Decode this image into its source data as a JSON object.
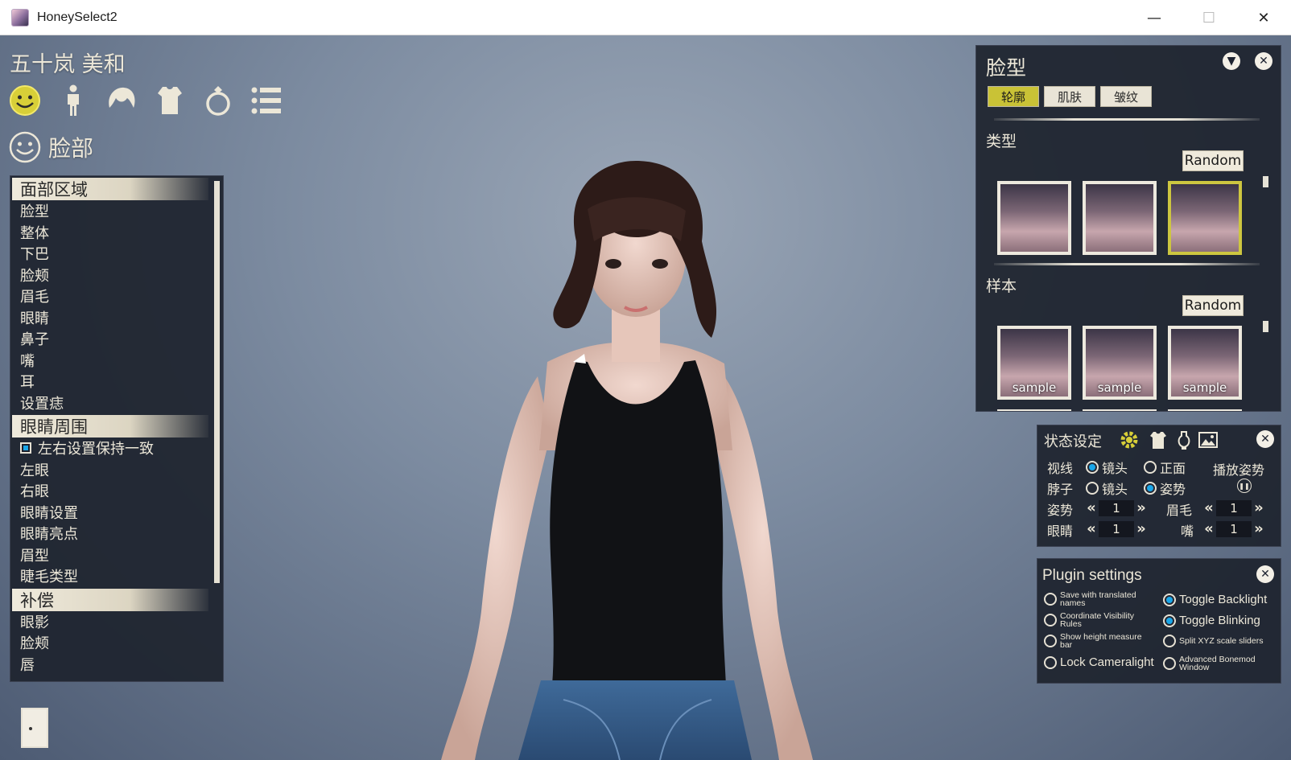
{
  "window": {
    "title": "HoneySelect2",
    "minimize": "—",
    "maximize": "☐",
    "close": "✕"
  },
  "character": {
    "name": "五十岚 美和"
  },
  "category_icons": [
    "face-icon",
    "body-icon",
    "hair-icon",
    "clothing-icon",
    "accessory-icon",
    "list-icon"
  ],
  "section": {
    "label": "脸部"
  },
  "left_menu": {
    "groups": [
      {
        "label": "面部区域",
        "items": [
          "脸型",
          "整体",
          "下巴",
          "脸颊",
          "眉毛",
          "眼睛",
          "鼻子",
          "嘴",
          "耳",
          "设置痣"
        ]
      },
      {
        "label": "眼睛周围",
        "check_item": "左右设置保持一致",
        "items": [
          "左眼",
          "右眼",
          "眼睛设置",
          "眼睛亮点",
          "眉型",
          "睫毛类型"
        ]
      },
      {
        "label": "补偿",
        "items": [
          "眼影",
          "脸颊",
          "唇"
        ]
      }
    ]
  },
  "face_panel": {
    "title": "脸型",
    "tabs": [
      {
        "label": "轮廓",
        "active": true
      },
      {
        "label": "肌肤",
        "active": false
      },
      {
        "label": "皱纹",
        "active": false
      }
    ],
    "type_label": "类型",
    "sample_label": "样本",
    "random_label": "Random",
    "type_selected_index": 2,
    "sample_caption": "sample"
  },
  "state_panel": {
    "title": "状态设定",
    "gaze_label": "视线",
    "gaze_camera": "镜头",
    "gaze_front": "正面",
    "neck_label": "脖子",
    "neck_camera": "镜头",
    "neck_pose": "姿势",
    "play_pose": "播放姿势",
    "pose_label": "姿势",
    "pose_value": "1",
    "brow_label": "眉毛",
    "brow_value": "1",
    "eyes_label": "眼睛",
    "eyes_value": "1",
    "mouth_label": "嘴",
    "mouth_value": "1"
  },
  "plugin_panel": {
    "title": "Plugin settings",
    "left_options": [
      {
        "label": "Save with translated names",
        "checked": false
      },
      {
        "label": "Coordinate Visibility Rules",
        "checked": false
      },
      {
        "label": "Show height measure bar",
        "checked": false
      },
      {
        "label": "Lock Cameralight",
        "checked": false
      }
    ],
    "right_options": [
      {
        "label": "Toggle Backlight",
        "checked": true
      },
      {
        "label": "Toggle Blinking",
        "checked": true
      },
      {
        "label": "Split XYZ scale sliders",
        "checked": false
      },
      {
        "label": "Advanced Bonemod Window",
        "checked": false
      }
    ]
  },
  "colors": {
    "accent_yellow": "#c9c236",
    "panel_bg": "#1e232e",
    "radio_blue": "#1aa6e8",
    "cream": "#ece7d8"
  }
}
